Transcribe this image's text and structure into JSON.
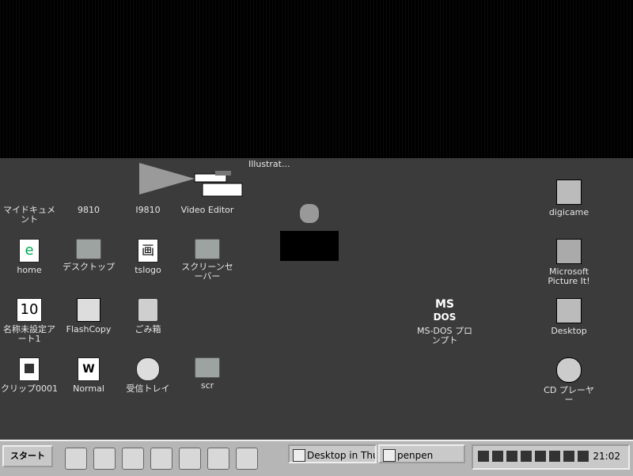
{
  "desktop_icons": [
    {
      "id": "my-documents",
      "label": "マイドキュメント",
      "type": "folder"
    },
    {
      "id": "9810",
      "label": "9810",
      "type": "app"
    },
    {
      "id": "i9810",
      "label": "I9810",
      "type": "app"
    },
    {
      "id": "video-editor",
      "label": "Video Editor",
      "type": "app"
    },
    {
      "id": "home",
      "label": "home",
      "type": "ie"
    },
    {
      "id": "desktop-shortcut",
      "label": "デスクトップ",
      "type": "folder"
    },
    {
      "id": "tslogo",
      "label": "tslogo",
      "type": "doc"
    },
    {
      "id": "screensaver",
      "label": "スクリーンセーバー",
      "type": "folder"
    },
    {
      "id": "untitled-art",
      "label": "名称未設定アート1",
      "type": "doc"
    },
    {
      "id": "flashcopy",
      "label": "FlashCopy",
      "type": "app"
    },
    {
      "id": "recycle-bin",
      "label": "ごみ箱",
      "type": "bin"
    },
    {
      "id": "clip0001",
      "label": "クリップ0001",
      "type": "doc"
    },
    {
      "id": "normal",
      "label": "Normal",
      "type": "word"
    },
    {
      "id": "inbox",
      "label": "受信トレイ",
      "type": "inbox"
    },
    {
      "id": "scr",
      "label": "scr",
      "type": "folder"
    },
    {
      "id": "ms-dos",
      "label": "MS-DOS プロンプト",
      "type": "msdos"
    },
    {
      "id": "digicame",
      "label": "digicame",
      "type": "app"
    },
    {
      "id": "ms-picture",
      "label": "Microsoft Picture It!",
      "type": "app"
    },
    {
      "id": "desktop",
      "label": "Desktop",
      "type": "app"
    },
    {
      "id": "cd-player",
      "label": "CD プレーヤー",
      "type": "app"
    }
  ],
  "floating_label": "Illustrat...",
  "taskbar": {
    "start_label": "スタート",
    "tasks": [
      {
        "label": "Desktop in Thu...",
        "active": true
      },
      {
        "label": "penpen",
        "active": false
      }
    ],
    "clock": "21:02"
  }
}
